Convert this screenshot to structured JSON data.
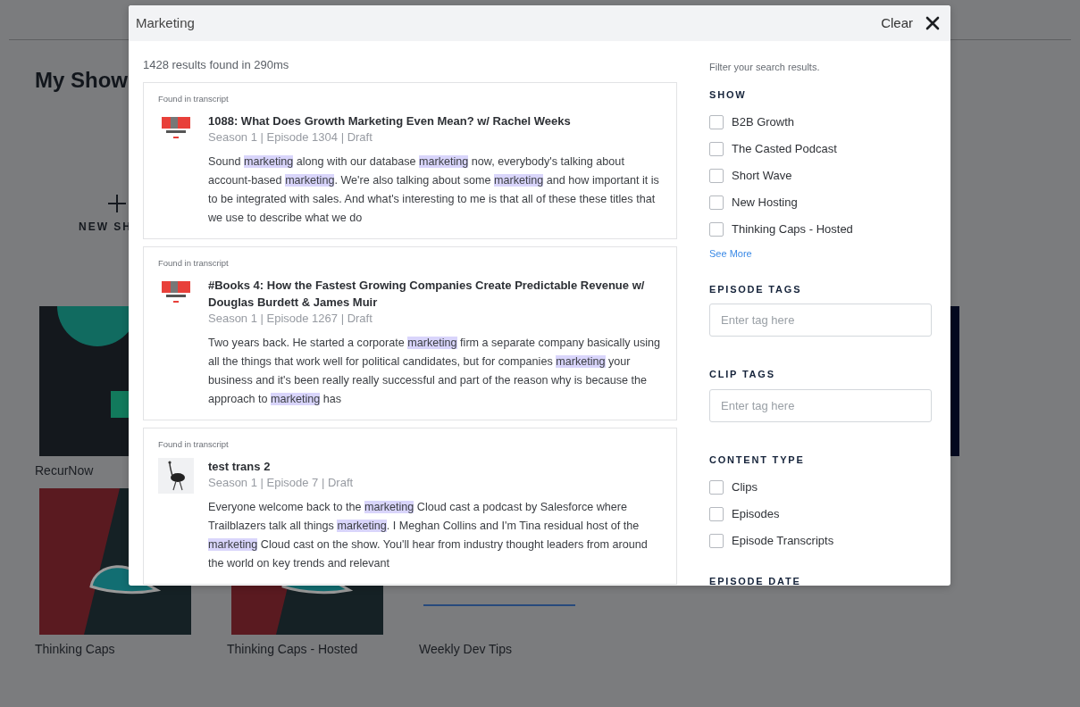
{
  "page": {
    "title": "My Show",
    "new_show_label": "NEW SH",
    "show_rows": [
      [
        {
          "name": "RecurNow",
          "kind": "recurnow"
        },
        null,
        null,
        null,
        {
          "kind": "navy"
        }
      ],
      [
        {
          "name": "Thinking Caps",
          "kind": "caps"
        },
        {
          "name": "Thinking Caps - Hosted",
          "kind": "caps"
        },
        {
          "name": "Weekly Dev Tips",
          "kind": "cartoon"
        }
      ]
    ]
  },
  "search_modal": {
    "query": "Marketing",
    "clear_label": "Clear",
    "results_summary": "1428 results found in 290ms",
    "results": [
      {
        "source": "Found in transcript",
        "kind": "b2b",
        "title": "1088: What Does Growth Marketing Even Mean? w/ Rachel Weeks",
        "meta": "Season 1 | Episode 1304 | Draft",
        "snippet": [
          {
            "text": "Sound ",
            "highlighted": false
          },
          {
            "text": "marketing",
            "highlighted": true
          },
          {
            "text": " along with our database ",
            "highlighted": false
          },
          {
            "text": "marketing",
            "highlighted": true
          },
          {
            "text": " now, everybody's talking about account-based ",
            "highlighted": false
          },
          {
            "text": "marketing",
            "highlighted": true
          },
          {
            "text": ". We're also talking about some ",
            "highlighted": false
          },
          {
            "text": "marketing",
            "highlighted": true
          },
          {
            "text": " and how important it is to be integrated with sales. And what's interesting to me is that all of these these titles that we use to describe what we do",
            "highlighted": false
          }
        ]
      },
      {
        "source": "Found in transcript",
        "kind": "b2b",
        "title": "#Books 4: How the Fastest Growing Companies Create Predictable Revenue w/ Douglas Burdett & James Muir",
        "meta": "Season 1 | Episode 1267 | Draft",
        "snippet": [
          {
            "text": "Two years back. He started a corporate ",
            "highlighted": false
          },
          {
            "text": "marketing",
            "highlighted": true
          },
          {
            "text": " firm a separate company basically using all the things that work well for political candidates, but for companies ",
            "highlighted": false
          },
          {
            "text": "marketing",
            "highlighted": true
          },
          {
            "text": " your business and it's been really really successful and part of the reason why is because the approach to ",
            "highlighted": false
          },
          {
            "text": "marketing",
            "highlighted": true
          },
          {
            "text": " has",
            "highlighted": false
          }
        ]
      },
      {
        "source": "Found in transcript",
        "kind": "ostrich",
        "title": "test trans 2",
        "meta": "Season 1 | Episode 7 | Draft",
        "snippet": [
          {
            "text": "Everyone welcome back to the ",
            "highlighted": false
          },
          {
            "text": "marketing",
            "highlighted": true
          },
          {
            "text": " Cloud cast a podcast by Salesforce where Trailblazers talk all things ",
            "highlighted": false
          },
          {
            "text": "marketing",
            "highlighted": true
          },
          {
            "text": ". I Meghan Collins and I'm Tina residual host of the ",
            "highlighted": false
          },
          {
            "text": "marketing",
            "highlighted": true
          },
          {
            "text": " Cloud cast on the show. You'll hear from industry thought leaders from around the world on key trends and relevant",
            "highlighted": false
          }
        ]
      }
    ],
    "filters": {
      "hint": "Filter your search results.",
      "sections": [
        {
          "kind": "checklist",
          "heading": "SHOW",
          "options": [
            {
              "label": "B2B Growth",
              "checked": false
            },
            {
              "label": "The Casted Podcast",
              "checked": false
            },
            {
              "label": "Short Wave",
              "checked": false
            },
            {
              "label": "New Hosting",
              "checked": false
            },
            {
              "label": "Thinking Caps - Hosted",
              "checked": false
            }
          ],
          "more_link": "See More"
        },
        {
          "kind": "tags",
          "heading": "EPISODE TAGS",
          "placeholder": "Enter tag here"
        },
        {
          "kind": "tags",
          "heading": "CLIP TAGS",
          "placeholder": "Enter tag here"
        },
        {
          "kind": "checklist",
          "heading": "CONTENT TYPE",
          "options": [
            {
              "label": "Clips",
              "checked": false
            },
            {
              "label": "Episodes",
              "checked": false
            },
            {
              "label": "Episode Transcripts",
              "checked": false
            }
          ]
        },
        {
          "kind": "heading",
          "heading": "EPISODE DATE"
        }
      ]
    }
  }
}
